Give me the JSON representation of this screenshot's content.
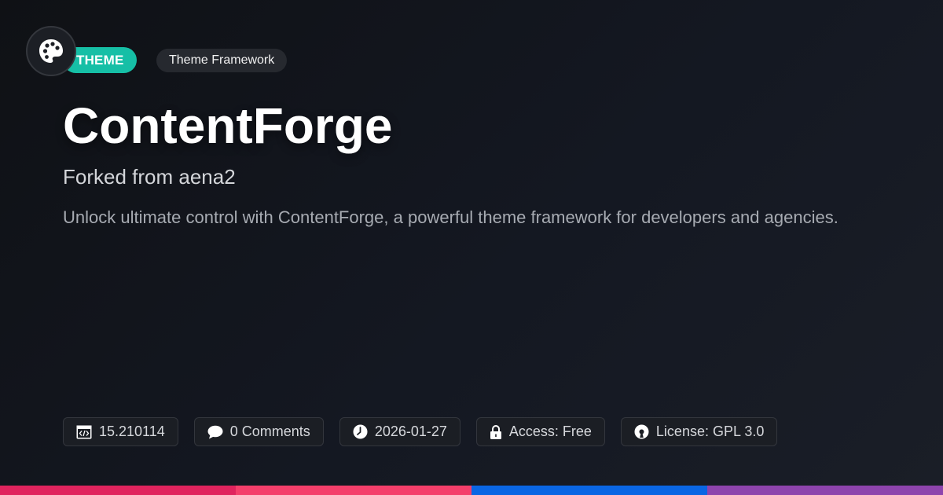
{
  "header": {
    "logo_icon": "palette-icon",
    "type_badge": "THEME",
    "category_badge": "Theme Framework"
  },
  "main": {
    "title": "ContentForge",
    "subtitle": "Forked from aena2",
    "description": "Unlock ultimate control with ContentForge, a powerful theme framework for developers and agencies."
  },
  "meta": {
    "version": {
      "icon": "code-icon",
      "text": "15.210114"
    },
    "comments": {
      "icon": "comment-icon",
      "text": "0 Comments"
    },
    "date": {
      "icon": "clock-icon",
      "text": "2026-01-27"
    },
    "access": {
      "icon": "lock-icon",
      "text": "Access: Free"
    },
    "license": {
      "icon": "open-source-icon",
      "text": "License: GPL 3.0"
    }
  },
  "colors": {
    "accent": "#16bfa6",
    "bar_segments": [
      "#e0245e",
      "#f43f6b",
      "#0a66e4",
      "#8e44ad"
    ]
  }
}
